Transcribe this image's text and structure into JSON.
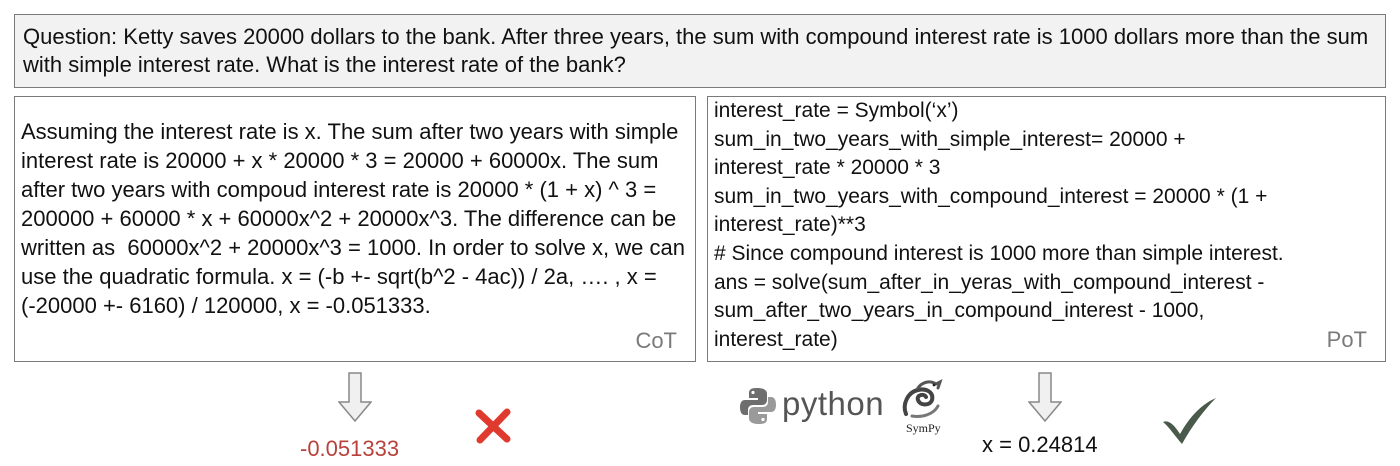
{
  "question": "Question: Ketty saves 20000 dollars to the bank. After three years, the sum with compound interest rate is 1000 dollars more than the sum with simple interest rate. What is the interest rate of the bank?",
  "cot": {
    "text": "Assuming the interest rate is x. The sum after two years with simple interest rate is 20000 + x * 20000 * 3 = 20000 + 60000x. The sum after two years with compoud interest rate is 20000 * (1 + x) ^ 3 = 200000 + 60000 * x + 60000x^2 + 20000x^3. The difference can be written as  60000x^2 + 20000x^3 = 1000. In order to solve x, we can use the quadratic formula. x = (-b +- sqrt(b^2 - 4ac)) / 2a, …. , x = (-20000 +- 6160) / 120000, x = -0.051333.",
    "label": "CoT",
    "answer": "-0.051333"
  },
  "pot": {
    "lines": [
      "interest_rate = Symbol(‘x’)",
      "sum_in_two_years_with_simple_interest= 20000 +",
      "interest_rate * 20000 * 3",
      "sum_in_two_years_with_compound_interest = 20000 * (1 +",
      "interest_rate)**3",
      "# Since compound interest is 1000 more than simple interest.",
      "ans = solve(sum_after_in_yeras_with_compound_interest -",
      "sum_after_two_years_in_compound_interest - 1000,",
      "interest_rate)"
    ],
    "label": "PoT",
    "answer": "x = 0.24814"
  },
  "logos": {
    "python": "python",
    "sympy": "SymPy"
  },
  "colors": {
    "wrong": "#e03a2f",
    "correct": "#4a5a4a",
    "arrow_fill": "#f0f0f0",
    "arrow_stroke": "#888888"
  }
}
